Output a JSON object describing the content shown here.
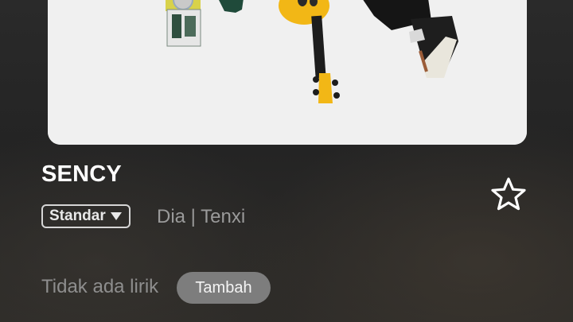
{
  "song": {
    "title": "SENCY",
    "artist": "Dia | Tenxi"
  },
  "quality": {
    "selected": "Standar",
    "icon": "triangle-down-icon"
  },
  "favorite": {
    "icon": "star-outline-icon"
  },
  "lyrics": {
    "status": "Tidak ada lirik",
    "add_label": "Tambah"
  },
  "colors": {
    "background": "#262626",
    "text_primary": "#ffffff",
    "text_secondary": "#9a9a9a",
    "button_bg": "#7d7d7d"
  }
}
